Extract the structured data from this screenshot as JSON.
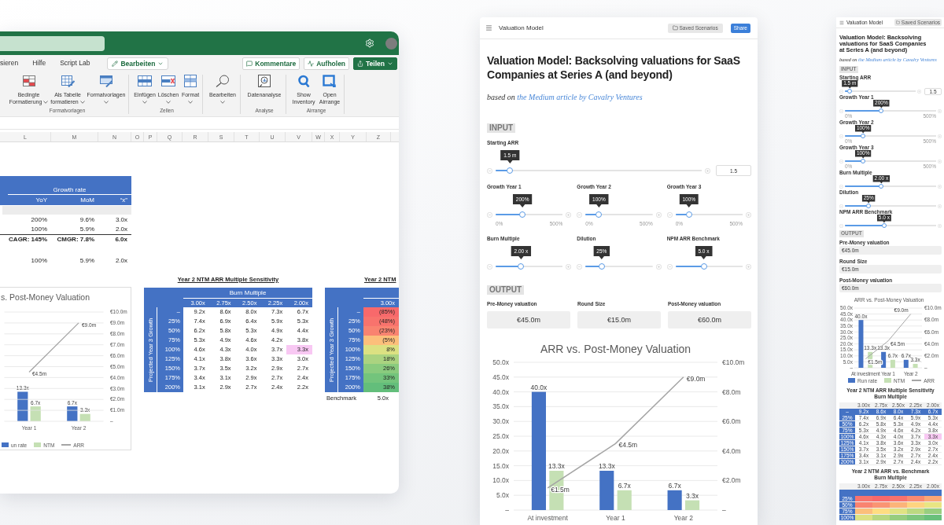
{
  "excel": {
    "ribbon_tabs": [
      {
        "label": "sieren",
        "selected": false
      },
      {
        "label": "Hilfe",
        "selected": false
      },
      {
        "label": "Script Lab",
        "selected": false
      }
    ],
    "mode_button": {
      "label": "Bearbeiten",
      "dropdown": true
    },
    "actions": [
      {
        "kind": "outline",
        "label": "Kommentare",
        "dropdown": false
      },
      {
        "kind": "outline",
        "label": "Aufholen",
        "dropdown": false
      },
      {
        "kind": "primary",
        "label": "Teilen",
        "dropdown": true
      }
    ],
    "ribbon_groups": [
      {
        "label": "Formatvorlagen",
        "commands": [
          {
            "label": "Bedingte Formatierung",
            "dropdown": true
          },
          {
            "label": "Als Tabelle formatieren",
            "dropdown": true
          },
          {
            "label": "Formatvorlagen",
            "dropdown": true
          }
        ]
      },
      {
        "label": "Zellen",
        "commands": [
          {
            "label": "Einfügen",
            "dropdown": true
          },
          {
            "label": "Löschen",
            "dropdown": true
          },
          {
            "label": "Format",
            "dropdown": true
          }
        ]
      },
      {
        "commands": [
          {
            "label": "Bearbeiten",
            "dropdown": true
          }
        ]
      },
      {
        "label": "Analyse",
        "commands": [
          {
            "label": "Datenanalyse",
            "dropdown": false
          }
        ]
      },
      {
        "label": "Airrange",
        "commands": [
          {
            "label": "Show Inventory",
            "dropdown": false
          },
          {
            "label": "Open Airrange",
            "dropdown": false
          }
        ]
      }
    ],
    "columns": [
      "L",
      "M",
      "N",
      "O",
      "P",
      "Q",
      "R",
      "S",
      "T",
      "U",
      "V",
      "W",
      "X",
      "Y",
      "Z"
    ],
    "growth_table": {
      "title": "Growth rate",
      "headers": [
        "YoY",
        "MoM",
        "“x”"
      ],
      "rows": [
        {
          "kind": "data",
          "cells": [
            "200%",
            "9.6%",
            "3.0x"
          ]
        },
        {
          "kind": "data",
          "cells": [
            "100%",
            "5.9%",
            "2.0x"
          ]
        },
        {
          "kind": "total",
          "cells": [
            "CAGR: 145%",
            "CMGR: 7.8%",
            "6.0x"
          ]
        },
        {
          "kind": "spaced",
          "cells": [
            "100%",
            "5.9%",
            "2.0x"
          ]
        }
      ]
    },
    "chart": {
      "bars": {
        "chart_data": {
          "type": "bar",
          "title": "s. Post-Money Valuation",
          "categories": [
            "Year 1",
            "Year 2"
          ],
          "series": [
            {
              "name": "un rate",
              "color": "#4472c4",
              "values": [
                13.3,
                6.7
              ],
              "value_labels": [
                "13.3x",
                "6.7x"
              ]
            },
            {
              "name": "NTM",
              "color": "#c5e0b4",
              "values": [
                6.7,
                3.3
              ],
              "value_labels": [
                "6.7x",
                "3.3x"
              ]
            }
          ]
        }
      },
      "line": {
        "chart_data": {
          "type": "line",
          "categories": [
            null,
            null
          ],
          "ylim": [
            0,
            10
          ],
          "grid": true,
          "yticks": [
            {
              "value": 0,
              "label": "–"
            },
            {
              "value": 1,
              "label": "€1.0m"
            },
            {
              "value": 2,
              "label": "€2.0m"
            },
            {
              "value": 3,
              "label": "€3.0m"
            },
            {
              "value": 4,
              "label": "€4.0m"
            },
            {
              "value": 5,
              "label": "€5.0m"
            },
            {
              "value": 6,
              "label": "€6.0m"
            },
            {
              "value": 7,
              "label": "€7.0m"
            },
            {
              "value": 8,
              "label": "€8.0m"
            },
            {
              "value": 9,
              "label": "€9.0m"
            },
            {
              "value": 10,
              "label": "€10.0m"
            }
          ],
          "series": [
            {
              "name": "ARR",
              "color": "#a5a5a5",
              "values": [
                4.5,
                9.0
              ],
              "value_labels": [
                "€4.5m",
                "€9.0m"
              ]
            }
          ]
        }
      }
    },
    "sensitivity_table": {
      "title": "Year 2 NTM ARR Multiple Sensitivity",
      "column_group": "Burn Multiple",
      "row_group": "Projected Year 3 Growth",
      "columns": [
        "3.00x",
        "2.75x",
        "2.50x",
        "2.25x",
        "2.00x"
      ],
      "rows": [
        {
          "label": "–",
          "cells": [
            {
              "text": "9.2x",
              "highlighted": false
            },
            {
              "text": "8.6x",
              "highlighted": false
            },
            {
              "text": "8.0x",
              "highlighted": false
            },
            {
              "text": "7.3x",
              "highlighted": false
            },
            {
              "text": "6.7x",
              "highlighted": false
            }
          ]
        },
        {
          "label": "25%",
          "cells": [
            {
              "text": "7.4x",
              "highlighted": false
            },
            {
              "text": "6.9x",
              "highlighted": false
            },
            {
              "text": "6.4x",
              "highlighted": false
            },
            {
              "text": "5.9x",
              "highlighted": false
            },
            {
              "text": "5.3x",
              "highlighted": false
            }
          ]
        },
        {
          "label": "50%",
          "cells": [
            {
              "text": "6.2x",
              "highlighted": false
            },
            {
              "text": "5.8x",
              "highlighted": false
            },
            {
              "text": "5.3x",
              "highlighted": false
            },
            {
              "text": "4.9x",
              "highlighted": false
            },
            {
              "text": "4.4x",
              "highlighted": false
            }
          ]
        },
        {
          "label": "75%",
          "cells": [
            {
              "text": "5.3x",
              "highlighted": false
            },
            {
              "text": "4.9x",
              "highlighted": false
            },
            {
              "text": "4.6x",
              "highlighted": false
            },
            {
              "text": "4.2x",
              "highlighted": false
            },
            {
              "text": "3.8x",
              "highlighted": false
            }
          ]
        },
        {
          "label": "100%",
          "cells": [
            {
              "text": "4.6x",
              "highlighted": false
            },
            {
              "text": "4.3x",
              "highlighted": false
            },
            {
              "text": "4.0x",
              "highlighted": false
            },
            {
              "text": "3.7x",
              "highlighted": false
            },
            {
              "text": "3.3x",
              "highlighted": true
            }
          ]
        },
        {
          "label": "125%",
          "cells": [
            {
              "text": "4.1x",
              "highlighted": false
            },
            {
              "text": "3.8x",
              "highlighted": false
            },
            {
              "text": "3.6x",
              "highlighted": false
            },
            {
              "text": "3.3x",
              "highlighted": false
            },
            {
              "text": "3.0x",
              "highlighted": false
            }
          ]
        },
        {
          "label": "150%",
          "cells": [
            {
              "text": "3.7x",
              "highlighted": false
            },
            {
              "text": "3.5x",
              "highlighted": false
            },
            {
              "text": "3.2x",
              "highlighted": false
            },
            {
              "text": "2.9x",
              "highlighted": false
            },
            {
              "text": "2.7x",
              "highlighted": false
            }
          ]
        },
        {
          "label": "175%",
          "cells": [
            {
              "text": "3.4x",
              "highlighted": false
            },
            {
              "text": "3.1x",
              "highlighted": false
            },
            {
              "text": "2.9x",
              "highlighted": false
            },
            {
              "text": "2.7x",
              "highlighted": false
            },
            {
              "text": "2.4x",
              "highlighted": false
            }
          ]
        },
        {
          "label": "200%",
          "cells": [
            {
              "text": "3.1x",
              "highlighted": false
            },
            {
              "text": "2.9x",
              "highlighted": false
            },
            {
              "text": "2.7x",
              "highlighted": false
            },
            {
              "text": "2.4x",
              "highlighted": false
            },
            {
              "text": "2.2x",
              "highlighted": false
            }
          ]
        }
      ]
    },
    "benchmark_table": {
      "title": "Year 2 NTM",
      "row_group": "Projected Year 3 Growth",
      "columns": [
        "3.00x"
      ],
      "rows": [
        {
          "label": "–",
          "cells": [
            {
              "text": "(85%)",
              "color": "#f8696b"
            }
          ]
        },
        {
          "label": "25%",
          "cells": [
            {
              "text": "(48%)",
              "color": "#f8736d"
            }
          ]
        },
        {
          "label": "50%",
          "cells": [
            {
              "text": "(23%)",
              "color": "#f98370"
            }
          ]
        },
        {
          "label": "75%",
          "cells": [
            {
              "text": "(5%)",
              "color": "#fcbf7b"
            }
          ]
        },
        {
          "label": "100%",
          "cells": [
            {
              "text": "8%",
              "color": "#dce182"
            }
          ]
        },
        {
          "label": "125%",
          "cells": [
            {
              "text": "18%",
              "color": "#abd380"
            }
          ]
        },
        {
          "label": "150%",
          "cells": [
            {
              "text": "26%",
              "color": "#8acb7e"
            }
          ]
        },
        {
          "label": "175%",
          "cells": [
            {
              "text": "33%",
              "color": "#73c47c"
            }
          ]
        },
        {
          "label": "200%",
          "cells": [
            {
              "text": "38%",
              "color": "#63be7b"
            }
          ]
        }
      ],
      "benchmark": {
        "label": "Benchmark",
        "value": "5.0x"
      }
    }
  },
  "app": {
    "header": {
      "title": "Valuation Model",
      "actions": [
        {
          "kind": "secondary",
          "label": "Saved Scenarios"
        },
        {
          "kind": "primary",
          "label": "Share"
        }
      ]
    },
    "heading": "Valuation Model: Backsolving valuations for SaaS Companies at Series A (and beyond)",
    "subtitle": {
      "text": "based on",
      "link": "the Medium article by Cavalry Ventures"
    },
    "input_section": {
      "label": "INPUT",
      "fields": [
        {
          "kind": "input",
          "label": "Starting ARR",
          "tooltip": "1.5 m",
          "level": 0.07,
          "value": "1.5"
        },
        {
          "kind": "range",
          "label": "Growth Year 1",
          "tooltip": "200%",
          "level": 0.4,
          "min_label": "0%",
          "max_label": "500%"
        },
        {
          "kind": "range",
          "label": "Growth Year 2",
          "tooltip": "100%",
          "level": 0.2,
          "min_label": "0%",
          "max_label": "500%"
        },
        {
          "kind": "range",
          "label": "Growth Year 3",
          "tooltip": "100%",
          "level": 0.2,
          "min_label": "0%",
          "max_label": "500%"
        },
        {
          "kind": "plain",
          "label": "Burn Multiple",
          "tooltip": "2.00 x",
          "level": 0.38
        },
        {
          "kind": "plain",
          "label": "Dilution",
          "tooltip": "25%",
          "level": 0.24
        },
        {
          "kind": "plain",
          "label": "NPM ARR Benchmark",
          "tooltip": "5.0 x",
          "level": 0.42
        }
      ]
    },
    "output_section": {
      "label": "OUTPUT",
      "fields": [
        {
          "label": "Pre-Money valuation",
          "value": "€45.0m"
        },
        {
          "label": "Round Size",
          "value": "€15.0m"
        },
        {
          "label": "Post-Money valuation",
          "value": "€60.0m"
        }
      ]
    },
    "chart": {
      "bars": {
        "chart_data": {
          "type": "bar",
          "title": "ARR vs. Post-Money Valuation",
          "categories": [
            "At investment",
            "Year 1",
            "Year 2"
          ],
          "ylim": [
            0,
            50
          ],
          "grid": true,
          "yticks": [
            {
              "value": 0,
              "label": "–"
            },
            {
              "value": 5,
              "label": "5.0x"
            },
            {
              "value": 10,
              "label": "10.0x"
            },
            {
              "value": 15,
              "label": "15.0x"
            },
            {
              "value": 20,
              "label": "20.0x"
            },
            {
              "value": 25,
              "label": "25.0x"
            },
            {
              "value": 30,
              "label": "30.0x"
            },
            {
              "value": 35,
              "label": "35.0x"
            },
            {
              "value": 40,
              "label": "40.0x"
            },
            {
              "value": 45,
              "label": "45.0x"
            },
            {
              "value": 50,
              "label": "50.0x"
            }
          ],
          "series": [
            {
              "color": "#4472c4",
              "values": [
                40,
                13.3,
                6.7
              ],
              "value_labels": [
                "40.0x",
                "13.3x",
                "6.7x"
              ]
            },
            {
              "color": "#c5e0b4",
              "values": [
                13.3,
                6.7,
                3.3
              ],
              "value_labels": [
                "13.3x",
                "6.7x",
                "3.3x"
              ]
            }
          ]
        }
      },
      "line": {
        "chart_data": {
          "type": "line",
          "categories": [
            null,
            null,
            null
          ],
          "ylim": [
            0,
            10
          ],
          "yticks": [
            {
              "value": 0,
              "label": "–"
            },
            {
              "value": 2,
              "label": "€2.0m"
            },
            {
              "value": 4,
              "label": "€4.0m"
            },
            {
              "value": 6,
              "label": "€6.0m"
            },
            {
              "value": 8,
              "label": "€8.0m"
            },
            {
              "value": 10,
              "label": "€10.0m"
            }
          ],
          "series": [
            {
              "color": "#a5a5a5",
              "values": [
                1.5,
                4.5,
                9.0
              ],
              "value_labels": [
                "€1.5m",
                "€4.5m",
                "€9.0m"
              ]
            }
          ]
        }
      }
    }
  },
  "mobile_preview": {
    "header": {
      "title": "Valuation Model",
      "actions": [
        {
          "kind": "secondary",
          "label": "Saved Scenarios"
        }
      ]
    },
    "heading": "Valuation Model: Backsolving valuations for SaaS Companies at Series A (and beyond)",
    "subtitle": {
      "text": "based on",
      "link": "the Medium article by Cavalry Ventures"
    },
    "input_section": {
      "label": "INPUT",
      "fields": [
        {
          "kind": "input",
          "label": "Starting ARR",
          "tooltip": "1.5 m",
          "level": 0.07,
          "value": "1.5"
        },
        {
          "kind": "range",
          "label": "Growth Year 1",
          "tooltip": "200%",
          "level": 0.4,
          "min_label": "0%",
          "max_label": "500%"
        },
        {
          "kind": "range",
          "label": "Growth Year 2",
          "tooltip": "100%",
          "level": 0.2,
          "min_label": "0%",
          "max_label": "500%"
        },
        {
          "kind": "range",
          "label": "Growth Year 3",
          "tooltip": "100%",
          "level": 0.2,
          "min_label": "0%",
          "max_label": "500%"
        },
        {
          "kind": "plain",
          "label": "Burn Multiple",
          "tooltip": "2.00 x",
          "level": 0.4
        },
        {
          "kind": "plain",
          "label": "Dilution",
          "tooltip": "25%",
          "level": 0.26
        },
        {
          "kind": "plain",
          "label": "NPM ARR Benchmark",
          "tooltip": "5.0 x",
          "level": 0.43
        }
      ]
    },
    "output_section": {
      "label": "OUTPUT",
      "fields": [
        {
          "label": "Pre-Money valuation",
          "value": "€45.0m"
        },
        {
          "label": "Round Size",
          "value": "€15.0m"
        },
        {
          "label": "Post-Money valuation",
          "value": "€60.0m"
        }
      ]
    },
    "chart": {
      "bars": {
        "chart_data": {
          "type": "bar",
          "title": "ARR vs. Post-Money Valuation",
          "categories": [
            "At investment",
            "Year 1",
            "Year 2"
          ],
          "ylim": [
            0,
            50
          ],
          "grid": true,
          "yticks": [
            {
              "value": 0,
              "label": "–"
            },
            {
              "value": 5,
              "label": "5.0x"
            },
            {
              "value": 10,
              "label": "10.0x"
            },
            {
              "value": 15,
              "label": "15.0x"
            },
            {
              "value": 20,
              "label": "20.0x"
            },
            {
              "value": 25,
              "label": "25.0x"
            },
            {
              "value": 30,
              "label": "30.0x"
            },
            {
              "value": 35,
              "label": "35.0x"
            },
            {
              "value": 40,
              "label": "40.0x"
            },
            {
              "value": 45,
              "label": "45.0x"
            },
            {
              "value": 50,
              "label": "50.0x"
            }
          ],
          "series": [
            {
              "name": "Run rate",
              "color": "#4472c4",
              "values": [
                40,
                13.3,
                6.7
              ],
              "value_labels": [
                "40.0x",
                "13.3x",
                "6.7x"
              ]
            },
            {
              "name": "NTM",
              "color": "#c5e0b4",
              "values": [
                13.3,
                6.7,
                3.3
              ],
              "value_labels": [
                "13.3x",
                "6.7x",
                "3.3x"
              ]
            }
          ]
        }
      },
      "line": {
        "chart_data": {
          "type": "line",
          "categories": [
            null,
            null,
            null
          ],
          "ylim": [
            0,
            10
          ],
          "yticks": [
            {
              "value": 0,
              "label": "–"
            },
            {
              "value": 2,
              "label": "€2.0m"
            },
            {
              "value": 4,
              "label": "€4.0m"
            },
            {
              "value": 6,
              "label": "€6.0m"
            },
            {
              "value": 8,
              "label": "€8.0m"
            },
            {
              "value": 10,
              "label": "€10.0m"
            }
          ],
          "series": [
            {
              "name": "ARR",
              "color": "#a5a5a5",
              "values": [
                1.5,
                4.5,
                9.0
              ],
              "value_labels": [
                "€1.5m",
                "€4.5m",
                "€9.0m"
              ]
            }
          ]
        }
      }
    },
    "tables": [
      {
        "kind": "values",
        "title": "Year 2 NTM ARR Multiple Sensitivity",
        "subtitle": "Burn Multiple",
        "columns": [
          "3.00x",
          "2.75x",
          "2.50x",
          "2.25x",
          "2.00x"
        ],
        "band": {
          "label": "–",
          "cells": [
            "9.2x",
            "8.6x",
            "8.0x",
            "7.3x",
            "6.7x"
          ]
        },
        "rows": [
          {
            "label": "25%",
            "cells": [
              {
                "text": "7.4x",
                "highlighted": false
              },
              {
                "text": "6.9x",
                "highlighted": false
              },
              {
                "text": "6.4x",
                "highlighted": false
              },
              {
                "text": "5.9x",
                "highlighted": false
              },
              {
                "text": "5.3x",
                "highlighted": false
              }
            ]
          },
          {
            "label": "50%",
            "cells": [
              {
                "text": "6.2x",
                "highlighted": false
              },
              {
                "text": "5.8x",
                "highlighted": false
              },
              {
                "text": "5.3x",
                "highlighted": false
              },
              {
                "text": "4.9x",
                "highlighted": false
              },
              {
                "text": "4.4x",
                "highlighted": false
              }
            ]
          },
          {
            "label": "75%",
            "cells": [
              {
                "text": "5.3x",
                "highlighted": false
              },
              {
                "text": "4.9x",
                "highlighted": false
              },
              {
                "text": "4.6x",
                "highlighted": false
              },
              {
                "text": "4.2x",
                "highlighted": false
              },
              {
                "text": "3.8x",
                "highlighted": false
              }
            ]
          },
          {
            "label": "100%",
            "cells": [
              {
                "text": "4.6x",
                "highlighted": false
              },
              {
                "text": "4.3x",
                "highlighted": false
              },
              {
                "text": "4.0x",
                "highlighted": false
              },
              {
                "text": "3.7x",
                "highlighted": false
              },
              {
                "text": "3.3x",
                "highlighted": true
              }
            ]
          },
          {
            "label": "125%",
            "cells": [
              {
                "text": "4.1x",
                "highlighted": false
              },
              {
                "text": "3.8x",
                "highlighted": false
              },
              {
                "text": "3.6x",
                "highlighted": false
              },
              {
                "text": "3.3x",
                "highlighted": false
              },
              {
                "text": "3.0x",
                "highlighted": false
              }
            ]
          },
          {
            "label": "150%",
            "cells": [
              {
                "text": "3.7x",
                "highlighted": false
              },
              {
                "text": "3.5x",
                "highlighted": false
              },
              {
                "text": "3.2x",
                "highlighted": false
              },
              {
                "text": "2.9x",
                "highlighted": false
              },
              {
                "text": "2.7x",
                "highlighted": false
              }
            ]
          },
          {
            "label": "175%",
            "cells": [
              {
                "text": "3.4x",
                "highlighted": false
              },
              {
                "text": "3.1x",
                "highlighted": false
              },
              {
                "text": "2.9x",
                "highlighted": false
              },
              {
                "text": "2.7x",
                "highlighted": false
              },
              {
                "text": "2.4x",
                "highlighted": false
              }
            ]
          },
          {
            "label": "200%",
            "cells": [
              {
                "text": "3.1x",
                "highlighted": false
              },
              {
                "text": "2.9x",
                "highlighted": false
              },
              {
                "text": "2.7x",
                "highlighted": false
              },
              {
                "text": "2.4x",
                "highlighted": false
              },
              {
                "text": "2.2x",
                "highlighted": false
              }
            ]
          }
        ]
      },
      {
        "kind": "heatmap",
        "title": "Year 2 NTM ARR vs. Benchmark",
        "subtitle": "Burn Multiple",
        "columns": [
          "3.00x",
          "2.75x",
          "2.50x",
          "2.25x",
          "2.00x"
        ],
        "rows": [
          {
            "label": "25%",
            "cells": [
              {
                "color": "#f8736d"
              },
              {
                "color": "#f8696b"
              },
              {
                "color": "#f8726d"
              },
              {
                "color": "#f98a71"
              },
              {
                "color": "#fba777"
              }
            ]
          },
          {
            "label": "50%",
            "cells": [
              {
                "color": "#f98370"
              },
              {
                "color": "#fa9473"
              },
              {
                "color": "#fcb479"
              },
              {
                "color": "#fed480"
              },
              {
                "color": "#e9e583"
              }
            ]
          },
          {
            "label": "75%",
            "cells": [
              {
                "color": "#fcbf7b"
              },
              {
                "color": "#fedd81"
              },
              {
                "color": "#e0e383"
              },
              {
                "color": "#bcd981"
              },
              {
                "color": "#98ce7f"
              }
            ]
          },
          {
            "label": "100%",
            "cells": [
              {
                "color": "#dce182"
              },
              {
                "color": "#b7d780"
              },
              {
                "color": "#96cd7e"
              },
              {
                "color": "#7ec67d"
              },
              {
                "color": "#69c07b"
              }
            ]
          }
        ]
      }
    ]
  }
}
